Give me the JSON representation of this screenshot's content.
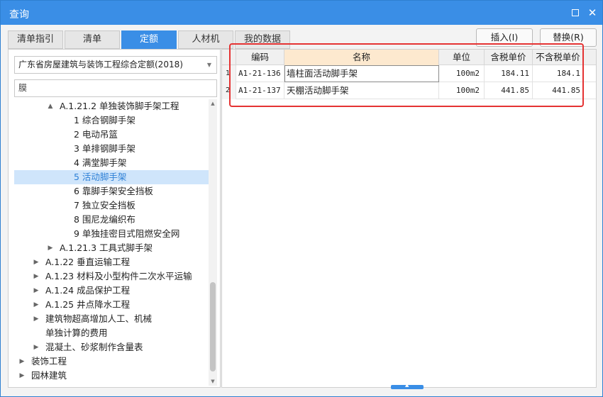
{
  "window": {
    "title": "查询",
    "maximize_icon": "maximize-icon",
    "close_icon": "close-icon",
    "accent_color": "#3a8ee6"
  },
  "tabs": [
    {
      "label": "清单指引",
      "active": false
    },
    {
      "label": "清单",
      "active": false
    },
    {
      "label": "定额",
      "active": true
    },
    {
      "label": "人材机",
      "active": false
    },
    {
      "label": "我的数据",
      "active": false
    }
  ],
  "actions": {
    "insert_label": "插入(I)",
    "replace_label": "替换(R)"
  },
  "left": {
    "quota_library": "广东省房屋建筑与装饰工程综合定额(2018)",
    "search_value": "膜"
  },
  "tree": [
    {
      "label": "A.1.21.2 单独装饰脚手架工程",
      "arrow": "▲",
      "selected": false
    },
    {
      "label": "1 综合钢脚手架",
      "arrow": "",
      "selected": false
    },
    {
      "label": "2 电动吊篮",
      "arrow": "",
      "selected": false
    },
    {
      "label": "3 单排钢脚手架",
      "arrow": "",
      "selected": false
    },
    {
      "label": "4 满堂脚手架",
      "arrow": "",
      "selected": false
    },
    {
      "label": "5 活动脚手架",
      "arrow": "",
      "selected": true
    },
    {
      "label": "6 靠脚手架安全挡板",
      "arrow": "",
      "selected": false
    },
    {
      "label": "7 独立安全挡板",
      "arrow": "",
      "selected": false
    },
    {
      "label": "8 围尼龙编织布",
      "arrow": "",
      "selected": false
    },
    {
      "label": "9 单独挂密目式阻燃安全网",
      "arrow": "",
      "selected": false
    },
    {
      "label": "A.1.21.3 工具式脚手架",
      "arrow": "▶",
      "selected": false
    },
    {
      "label": "A.1.22 垂直运输工程",
      "arrow": "▶",
      "selected": false
    },
    {
      "label": "A.1.23 材料及小型构件二次水平运输",
      "arrow": "▶",
      "selected": false
    },
    {
      "label": "A.1.24 成品保护工程",
      "arrow": "▶",
      "selected": false
    },
    {
      "label": "A.1.25 井点降水工程",
      "arrow": "▶",
      "selected": false
    },
    {
      "label": "建筑物超高增加人工、机械",
      "arrow": "▶",
      "selected": false
    },
    {
      "label": "单独计算的费用",
      "arrow": "",
      "selected": false
    },
    {
      "label": "混凝土、砂浆制作含量表",
      "arrow": "▶",
      "selected": false
    },
    {
      "label": "装饰工程",
      "arrow": "▶",
      "selected": false
    },
    {
      "label": "园林建筑",
      "arrow": "▶",
      "selected": false
    }
  ],
  "grid": {
    "columns": [
      "编码",
      "名称",
      "单位",
      "含税单价",
      "不含税单价"
    ],
    "rows": [
      {
        "num": "1",
        "code": "A1-21-136",
        "name": "墙柱面活动脚手架",
        "unit": "100m2",
        "price_tax": "184.11",
        "price_notax": "184.1"
      },
      {
        "num": "2",
        "code": "A1-21-137",
        "name": "天棚活动脚手架",
        "unit": "100m2",
        "price_tax": "441.85",
        "price_notax": "441.85"
      }
    ]
  },
  "colors": {
    "selection_bg": "#cfe5fb",
    "name_header_bg": "#fde9cf",
    "highlight_border": "#e53333"
  }
}
